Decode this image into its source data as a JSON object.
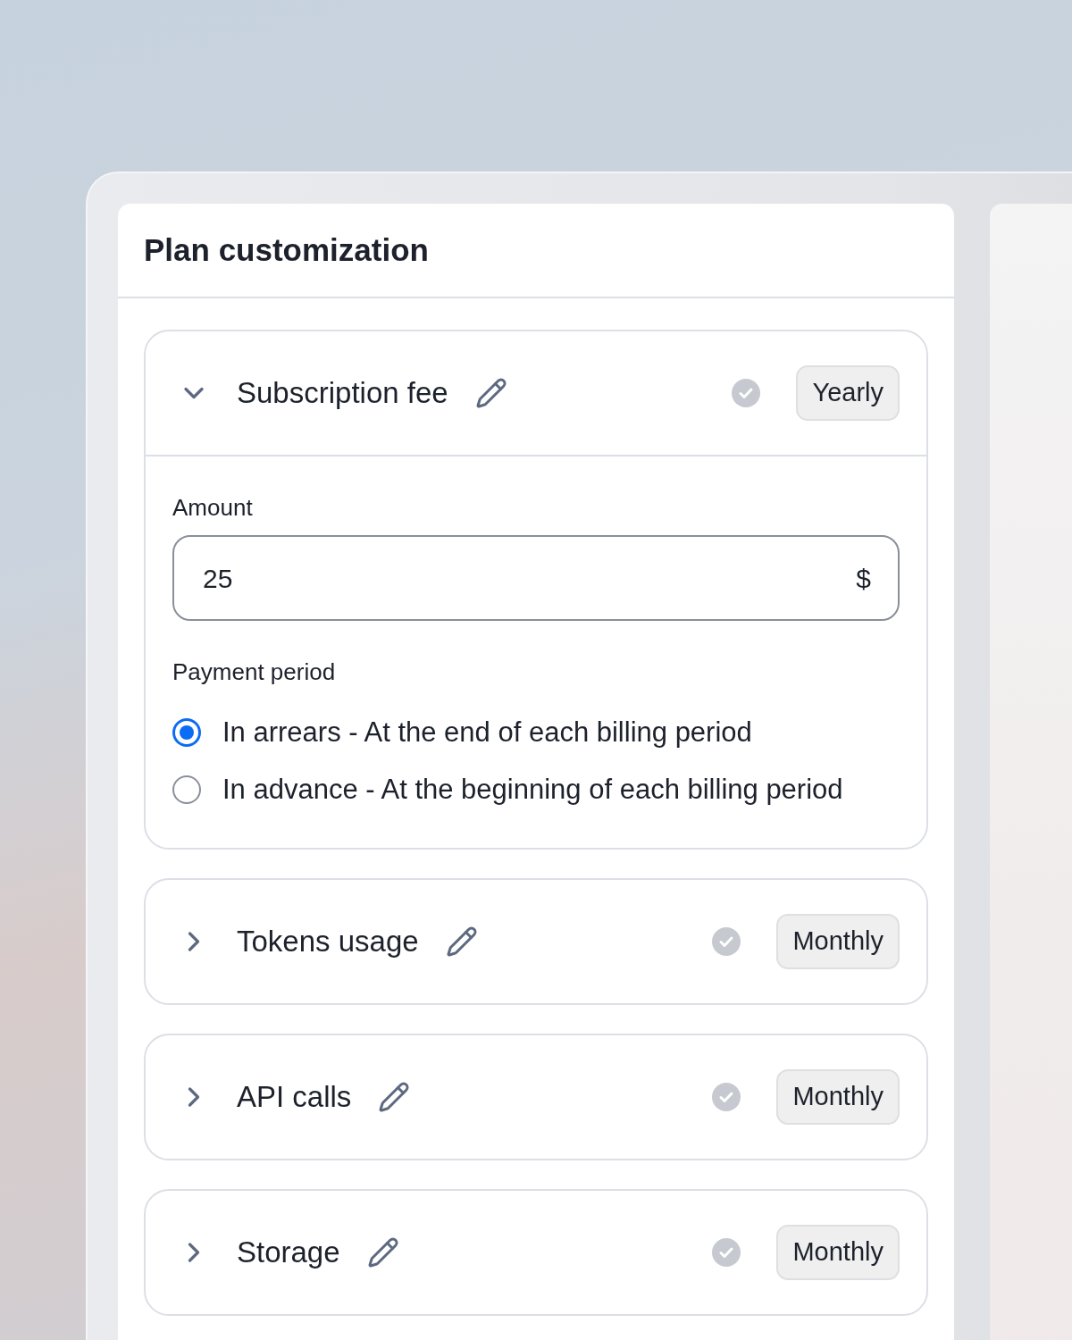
{
  "panel": {
    "title": "Plan customization"
  },
  "sections": [
    {
      "title": "Subscription fee",
      "expanded": true,
      "badge": "Yearly",
      "amount": {
        "label": "Amount",
        "value": "25",
        "suffix": "$"
      },
      "payment_period": {
        "label": "Payment period",
        "options": [
          {
            "label": "In arrears - At the end of each billing period",
            "selected": true
          },
          {
            "label": "In advance - At the beginning of each billing period",
            "selected": false
          }
        ]
      }
    },
    {
      "title": "Tokens usage",
      "expanded": false,
      "badge": "Monthly"
    },
    {
      "title": "API calls",
      "expanded": false,
      "badge": "Monthly"
    },
    {
      "title": "Storage",
      "expanded": false,
      "badge": "Monthly"
    }
  ]
}
